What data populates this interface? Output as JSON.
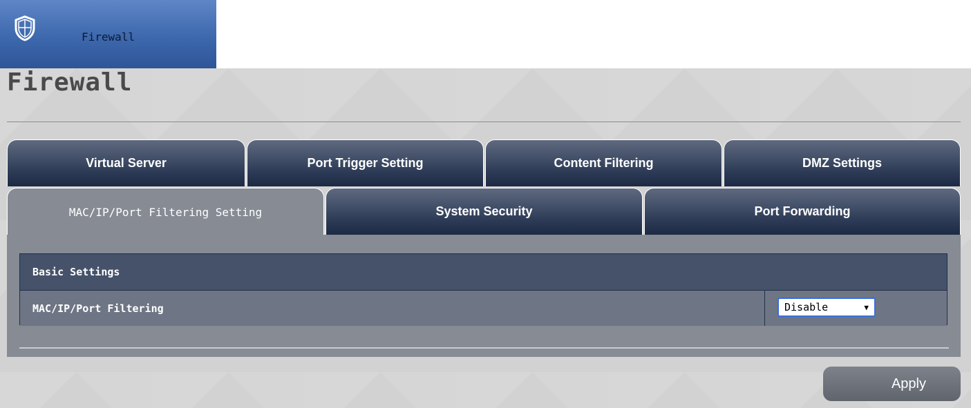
{
  "nav": {
    "label": "Firewall",
    "icon": "shield-icon"
  },
  "page": {
    "title": "Firewall"
  },
  "tabs_row1": [
    {
      "label": "Virtual Server"
    },
    {
      "label": "Port Trigger Setting"
    },
    {
      "label": "Content Filtering"
    },
    {
      "label": "DMZ Settings"
    }
  ],
  "tabs_row2": [
    {
      "label": "MAC/IP/Port Filtering Setting",
      "active": true
    },
    {
      "label": "System Security"
    },
    {
      "label": "Port Forwarding"
    }
  ],
  "settings": {
    "header": "Basic Settings",
    "row_label": "MAC/IP/Port Filtering",
    "select_value": "Disable",
    "caret": "▼"
  },
  "actions": {
    "apply_label": "Apply"
  },
  "colors": {
    "nav_tile": "#3d68ad",
    "tab_dark": "#2c3a55",
    "panel": "#868b94",
    "header": "#45526a",
    "select_border": "#3a6fd8"
  }
}
